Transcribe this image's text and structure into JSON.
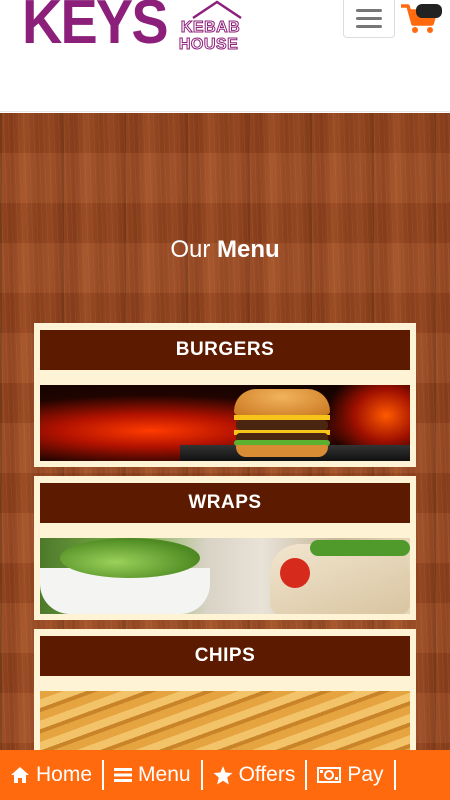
{
  "header": {
    "logo_main": "KEYS",
    "logo_line1": "KEBAB",
    "logo_line2": "HOUSE",
    "menu_icon": "hamburger-icon",
    "cart_icon": "shopping-cart-icon"
  },
  "main": {
    "title_thin": "Our",
    "title_bold": "Menu",
    "categories": [
      {
        "label": "BURGERS"
      },
      {
        "label": "WRAPS"
      },
      {
        "label": "CHIPS"
      }
    ]
  },
  "bottom_nav": [
    {
      "label": "Home",
      "icon": "home-icon"
    },
    {
      "label": "Menu",
      "icon": "list-icon"
    },
    {
      "label": "Offers",
      "icon": "star-icon"
    },
    {
      "label": "Pay",
      "icon": "money-icon"
    }
  ],
  "colors": {
    "brand": "#8c1f7a",
    "accent": "#ff6a0f",
    "card_header": "#5c1a00"
  }
}
